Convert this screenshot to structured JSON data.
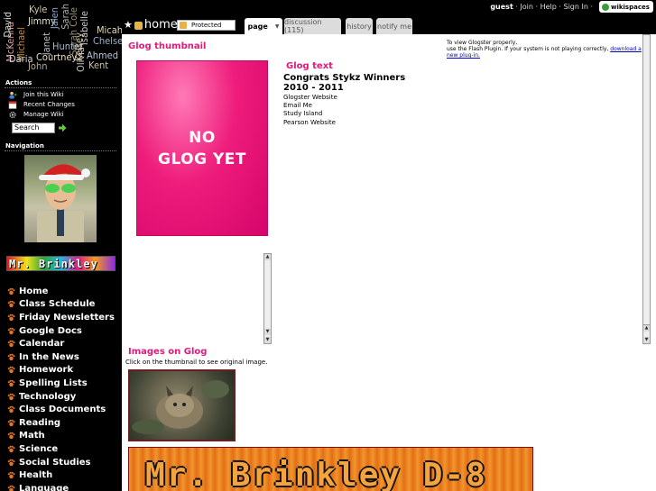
{
  "sidebar": {
    "tags": [
      "David",
      "Kyle",
      "Jimmy",
      "Jalen",
      "Sarah",
      "Sarah Cole",
      "Isabelle",
      "Micah",
      "McKenna",
      "Michael",
      "Janet",
      "Hunter",
      "Kelsey",
      "Chelsea",
      "Daria",
      "John",
      "Courtney",
      "Olivia",
      "Ahmed",
      "Kent",
      "Kelly"
    ],
    "actions_heading": "Actions",
    "actions": [
      {
        "label": "Join this Wiki",
        "icon": "user-add-icon"
      },
      {
        "label": "Recent Changes",
        "icon": "calendar-icon"
      },
      {
        "label": "Manage Wiki",
        "icon": "gear-icon"
      }
    ],
    "search_value": "Search",
    "navigation_heading": "Navigation",
    "banner_text": "Mr. Brinkley",
    "nav_items": [
      "Home",
      "Class Schedule",
      "Friday Newsletters",
      "Google Docs",
      "Calendar",
      "In the News",
      "Homework",
      "Spelling Lists",
      "Technology",
      "Class Documents",
      "Reading",
      "Math",
      "Science",
      "Social Studies",
      "Health",
      "Language"
    ]
  },
  "topbar": {
    "user": "guest",
    "links": [
      "Join",
      "Help",
      "Sign In"
    ],
    "brand": "wikispaces",
    "page_title": "home",
    "protected_label": "Protected",
    "tabs": [
      "page",
      "discussion (115)",
      "history",
      "notify me"
    ]
  },
  "main": {
    "glog_thumbnail_heading": "Glog thumbnail",
    "flash_note_line1": "To view Glogster properly,",
    "flash_note_line2": "use the Flash Plugin. If your system is not playing correctly,",
    "flash_note_link": "download a new plug-in.",
    "no_glog_line1": "NO",
    "no_glog_line2": "GLOG YET",
    "glog_text_heading": "Glog text",
    "congrats_line1": "Congrats Stykz Winners",
    "congrats_line2": "2010 - 2011",
    "links": [
      "Glogster Website",
      "Email Me",
      "Study Island",
      "Pearson Website"
    ],
    "images_heading": "Images on Glog",
    "images_note": "Click on the thumbnail to see original image.",
    "bottom_banner": "Mr. Brinkley D-8"
  },
  "colors": {
    "accent": "#e0197b",
    "sidebar_bg": "#000000",
    "nav_paw": "#e8731a"
  }
}
